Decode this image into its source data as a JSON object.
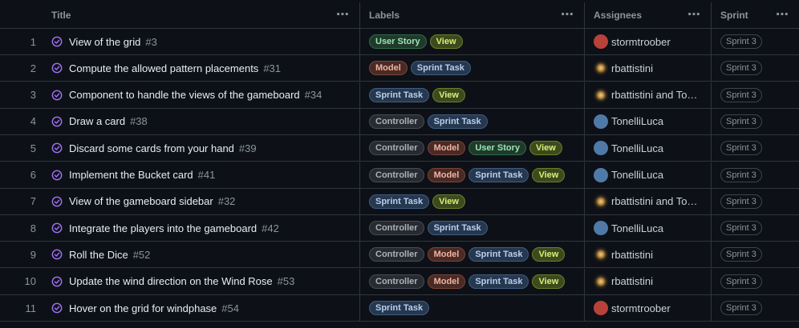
{
  "columns": {
    "title": "Title",
    "labels": "Labels",
    "assignees": "Assignees",
    "sprint": "Sprint"
  },
  "label_colors": {
    "User Story": {
      "bg": "#1f3a2b",
      "border": "#2e6b47",
      "fg": "#9fe3b4"
    },
    "View": {
      "bg": "#3d4a1c",
      "border": "#6b7f2b",
      "fg": "#d8f07a"
    },
    "Model": {
      "bg": "#4a2a24",
      "border": "#7a4438",
      "fg": "#f0b3a3"
    },
    "Sprint Task": {
      "bg": "#26384f",
      "border": "#3f5c80",
      "fg": "#b7cfee"
    },
    "Controller": {
      "bg": "#272b31",
      "border": "#464c55",
      "fg": "#aab1bb"
    }
  },
  "avatar_colors": {
    "stormtroober": "#b8423a",
    "rbattistini": "#2a2218",
    "TonelliLuca": "#4f7aa8",
    "rbattistini and To…": "#2a2218"
  },
  "rows": [
    {
      "num": "1",
      "title": "View of the grid",
      "issue": "#3",
      "labels": [
        "User Story",
        "View"
      ],
      "assignee": "stormtroober",
      "sprint": "Sprint 3"
    },
    {
      "num": "2",
      "title": "Compute the allowed pattern placements",
      "issue": "#31",
      "labels": [
        "Model",
        "Sprint Task"
      ],
      "assignee": "rbattistini",
      "sprint": "Sprint 3"
    },
    {
      "num": "3",
      "title": "Component to handle the views of the gameboard",
      "issue": "#34",
      "labels": [
        "Sprint Task",
        "View"
      ],
      "assignee": "rbattistini and To…",
      "sprint": "Sprint 3"
    },
    {
      "num": "4",
      "title": "Draw a card",
      "issue": "#38",
      "labels": [
        "Controller",
        "Sprint Task"
      ],
      "assignee": "TonelliLuca",
      "sprint": "Sprint 3"
    },
    {
      "num": "5",
      "title": "Discard some cards from your hand",
      "issue": "#39",
      "labels": [
        "Controller",
        "Model",
        "User Story",
        "View"
      ],
      "assignee": "TonelliLuca",
      "sprint": "Sprint 3"
    },
    {
      "num": "6",
      "title": "Implement the Bucket card",
      "issue": "#41",
      "labels": [
        "Controller",
        "Model",
        "Sprint Task",
        "View"
      ],
      "assignee": "TonelliLuca",
      "sprint": "Sprint 3"
    },
    {
      "num": "7",
      "title": "View of the gameboard sidebar",
      "issue": "#32",
      "labels": [
        "Sprint Task",
        "View"
      ],
      "assignee": "rbattistini and To…",
      "sprint": "Sprint 3"
    },
    {
      "num": "8",
      "title": "Integrate the players into the gameboard",
      "issue": "#42",
      "labels": [
        "Controller",
        "Sprint Task"
      ],
      "assignee": "TonelliLuca",
      "sprint": "Sprint 3"
    },
    {
      "num": "9",
      "title": "Roll the Dice",
      "issue": "#52",
      "labels": [
        "Controller",
        "Model",
        "Sprint Task",
        "View"
      ],
      "assignee": "rbattistini",
      "sprint": "Sprint 3"
    },
    {
      "num": "10",
      "title": "Update the wind direction on the Wind Rose",
      "issue": "#53",
      "labels": [
        "Controller",
        "Model",
        "Sprint Task",
        "View"
      ],
      "assignee": "rbattistini",
      "sprint": "Sprint 3"
    },
    {
      "num": "11",
      "title": "Hover on the grid for windphase",
      "issue": "#54",
      "labels": [
        "Sprint Task"
      ],
      "assignee": "stormtroober",
      "sprint": "Sprint 3"
    }
  ]
}
